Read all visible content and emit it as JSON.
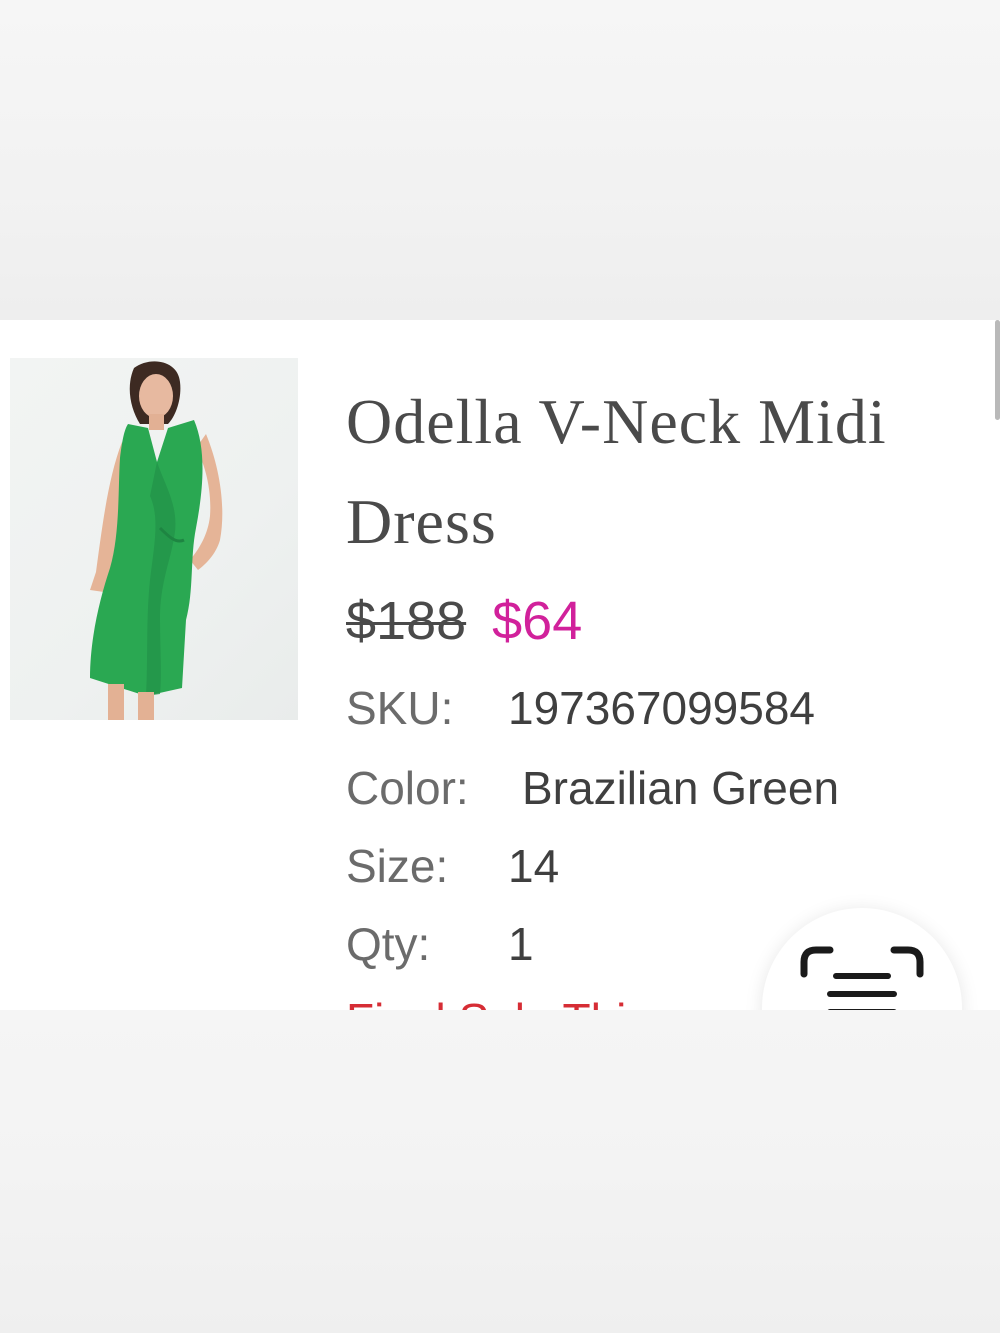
{
  "product": {
    "title": "Odella V-Neck Midi Dress",
    "image_alt": "Model wearing green V-neck midi dress",
    "price_original": "$188",
    "price_sale": "$64",
    "sku_label": "SKU:",
    "sku_value": "197367099584",
    "color_label": "Color:",
    "color_value": "Brazilian Green",
    "size_label": "Size:",
    "size_value": "14",
    "qty_label": "Qty:",
    "qty_value": "1",
    "final_sale_text": "Final Sale This"
  },
  "scan_button": {
    "icon": "scan-text-icon"
  },
  "colors": {
    "sale_price": "#d1219b",
    "final_sale": "#d62d35",
    "dress_green": "#2aa852",
    "text_dark": "#4a4a4a"
  }
}
